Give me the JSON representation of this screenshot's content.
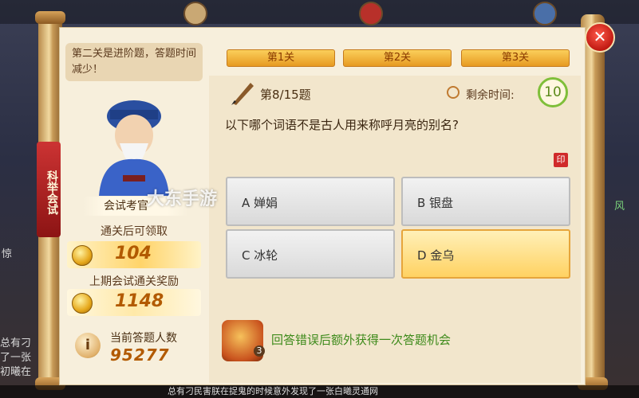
{
  "side": {
    "left_frag_1": "惊",
    "left_frag_2": "总有刁",
    "left_frag_3": "了一张",
    "left_frag_4": "初曦在",
    "right_frag_1": "风"
  },
  "banner": {
    "title": "科举会试"
  },
  "stages": [
    {
      "label": "第1关"
    },
    {
      "label": "第2关"
    },
    {
      "label": "第3关"
    }
  ],
  "left_panel": {
    "notice": "第二关是进阶题，答题时间减少！",
    "examiner": "会试考官",
    "reward_label": "通关后可领取",
    "reward_value": "104",
    "last_reward_label": "上期会试通关奖励",
    "last_reward_value": "1148",
    "count_label": "当前答题人数",
    "count_value": "95277"
  },
  "question": {
    "number": "第8/15题",
    "timer_label": "剩余时间:",
    "timer_value": "10",
    "text": "以下哪个词语不是古人用来称呼月亮的别名?",
    "stamp": "印"
  },
  "answers": [
    {
      "label": "A 婵娟",
      "selected": false
    },
    {
      "label": "B 银盘",
      "selected": false
    },
    {
      "label": "C 冰轮",
      "selected": false
    },
    {
      "label": "D 金乌",
      "selected": true
    }
  ],
  "hint": {
    "count": "3",
    "text": "回答错误后额外获得一次答题机会"
  },
  "watermark": "大东手游",
  "bottom_text": "总有刁民害朕在捉鬼的时候意外发现了一张白曦灵通网",
  "close_symbol": "✕"
}
